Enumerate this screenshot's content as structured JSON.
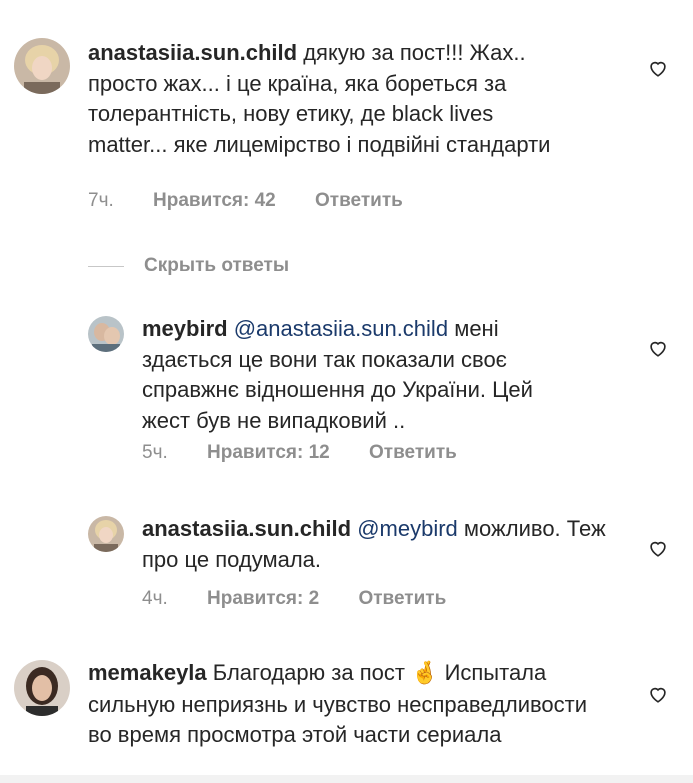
{
  "comments": [
    {
      "username": "anastasiia.sun.child",
      "text": "дякую за пост!!! Жах.. просто жах... і це країна, яка бореться за толерантність, нову етику, де black lives matter... яке лицемірство і подвійні стандарти",
      "time": "7ч.",
      "likes": "Нравится: 42",
      "reply": "Ответить"
    },
    {
      "username": "meybird",
      "mention": "@anastasiia.sun.child",
      "text": "мені здається це вони так показали своє справжнє відношення до України. Цей жест був не випадковий ..",
      "time": "5ч.",
      "likes": "Нравится: 12",
      "reply": "Ответить"
    },
    {
      "username": "anastasiia.sun.child",
      "mention": "@meybird",
      "text": "можливо. Теж про це подумала.",
      "time": "4ч.",
      "likes": "Нравится: 2",
      "reply": "Ответить"
    },
    {
      "username": "memakeyla",
      "text": "Благодарю за пост",
      "emoji": "🤞",
      "text2": "Испытала сильную неприязнь и чувство несправедливости во время просмотра этой части сериала"
    }
  ],
  "hide_replies": "Скрыть ответы",
  "icons": {
    "like": "heart-outline-icon"
  },
  "colors": {
    "text": "#262626",
    "meta": "#8e8e8e",
    "mention": "#1b3a6b"
  }
}
